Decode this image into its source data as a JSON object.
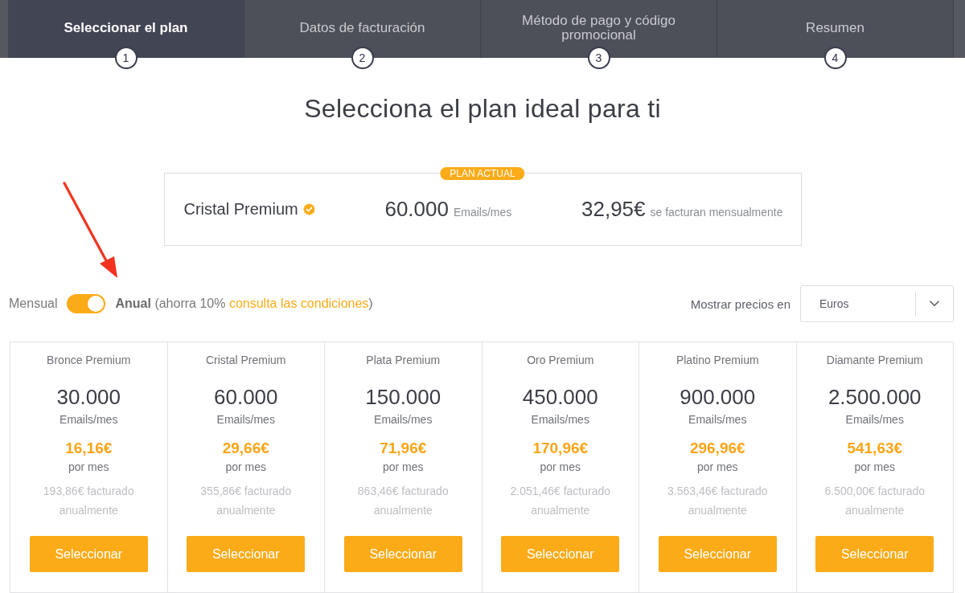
{
  "steps": [
    {
      "label": "Seleccionar el plan",
      "number": "1",
      "selected": true
    },
    {
      "label": "Datos de facturación",
      "number": "2",
      "selected": false
    },
    {
      "label": "Método de pago y código promocional",
      "number": "3",
      "selected": false
    },
    {
      "label": "Resumen",
      "number": "4",
      "selected": false
    }
  ],
  "title": "Selecciona el plan ideal para ti",
  "current_plan": {
    "badge": "PLAN ACTUAL",
    "name": "Cristal Premium",
    "verified": true,
    "emails": "60.000",
    "emails_unit": "Emails/mes",
    "price": "32,95€",
    "price_note": "se facturan mensualmente"
  },
  "billing": {
    "monthly_label": "Mensual",
    "annual": true,
    "note": "**Anual** (ahorra 10%",
    "link": "consulta las condiciones",
    "note_end": ")"
  },
  "currency": {
    "label": "Mostrar precios en",
    "value": "Euros"
  },
  "plans": [
    {
      "name": "Bronce Premium",
      "emails": "30.000",
      "emails_unit": "Emails/mes",
      "price": "16,16€",
      "price_period": "por mes",
      "billed": "193,86€ facturado anualmente",
      "button": "Seleccionar"
    },
    {
      "name": "Cristal Premium",
      "emails": "60.000",
      "emails_unit": "Emails/mes",
      "price": "29,66€",
      "price_period": "por mes",
      "billed": "355,86€ facturado anualmente",
      "button": "Seleccionar"
    },
    {
      "name": "Plata Premium",
      "emails": "150.000",
      "emails_unit": "Emails/mes",
      "price": "71,96€",
      "price_period": "por mes",
      "billed": "863,46€ facturado anualmente",
      "button": "Seleccionar"
    },
    {
      "name": "Oro Premium",
      "emails": "450.000",
      "emails_unit": "Emails/mes",
      "price": "170,96€",
      "price_period": "por mes",
      "billed": "2.051,46€ facturado anualmente",
      "button": "Seleccionar"
    },
    {
      "name": "Platino Premium",
      "emails": "900.000",
      "emails_unit": "Emails/mes",
      "price": "296,96€",
      "price_period": "por mes",
      "billed": "3.563,46€ facturado anualmente",
      "button": "Seleccionar"
    },
    {
      "name": "Diamante Premium",
      "emails": "2.500.000",
      "emails_unit": "Emails/mes",
      "price": "541,63€",
      "price_period": "por mes",
      "billed": "6.500,00€ facturado anualmente",
      "button": "Seleccionar"
    }
  ]
}
